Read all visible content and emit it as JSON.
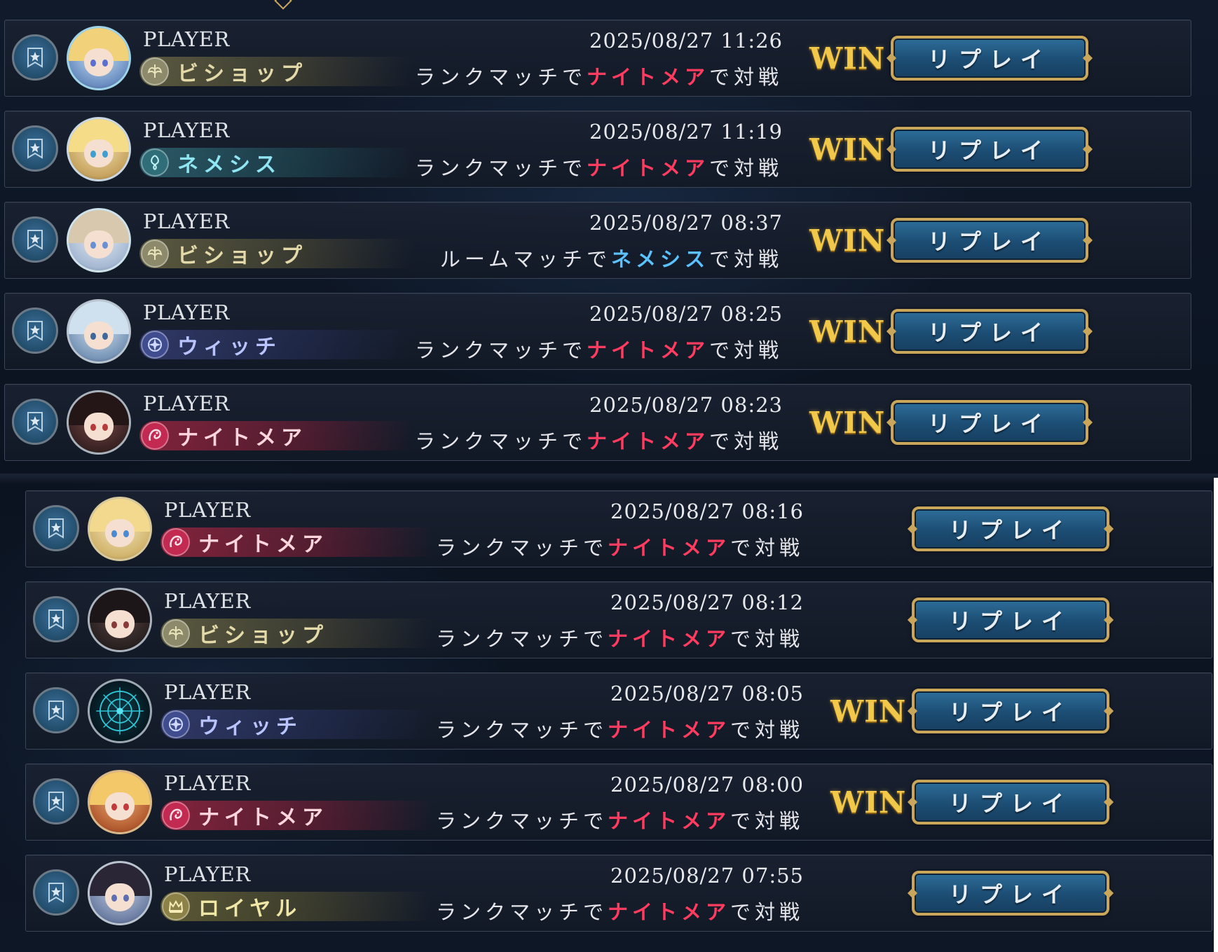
{
  "colors": {
    "nightmare": "#ff3c5f",
    "nemesis": "#5cc2ff",
    "win": "#f2c84b",
    "replay_bg": "#1c4d73",
    "replay_border": "#c9a65a"
  },
  "matches": [
    {
      "player": "PLAYER",
      "class": "ビショップ",
      "class_key": "bishop",
      "datetime": "2025/08/27 11:26",
      "mode": "ランクマッチで",
      "opponent": "ナイトメア",
      "opp_key": "nightmare",
      "suffix": "で対戦",
      "result": "WIN",
      "replay": "リプレイ"
    },
    {
      "player": "PLAYER",
      "class": "ネメシス",
      "class_key": "nemesis",
      "datetime": "2025/08/27 11:19",
      "mode": "ランクマッチで",
      "opponent": "ナイトメア",
      "opp_key": "nightmare",
      "suffix": "で対戦",
      "result": "WIN",
      "replay": "リプレイ"
    },
    {
      "player": "PLAYER",
      "class": "ビショップ",
      "class_key": "bishop",
      "datetime": "2025/08/27 08:37",
      "mode": "ルームマッチで",
      "opponent": "ネメシス",
      "opp_key": "nemesis",
      "suffix": "で対戦",
      "result": "WIN",
      "replay": "リプレイ"
    },
    {
      "player": "PLAYER",
      "class": "ウィッチ",
      "class_key": "witch",
      "datetime": "2025/08/27 08:25",
      "mode": "ランクマッチで",
      "opponent": "ナイトメア",
      "opp_key": "nightmare",
      "suffix": "で対戦",
      "result": "WIN",
      "replay": "リプレイ"
    },
    {
      "player": "PLAYER",
      "class": "ナイトメア",
      "class_key": "nightmare",
      "datetime": "2025/08/27 08:23",
      "mode": "ランクマッチで",
      "opponent": "ナイトメア",
      "opp_key": "nightmare",
      "suffix": "で対戦",
      "result": "WIN",
      "replay": "リプレイ"
    },
    {
      "player": "PLAYER",
      "class": "ナイトメア",
      "class_key": "nightmare",
      "datetime": "2025/08/27 08:16",
      "mode": "ランクマッチで",
      "opponent": "ナイトメア",
      "opp_key": "nightmare",
      "suffix": "で対戦",
      "result": "",
      "replay": "リプレイ"
    },
    {
      "player": "PLAYER",
      "class": "ビショップ",
      "class_key": "bishop",
      "datetime": "2025/08/27 08:12",
      "mode": "ランクマッチで",
      "opponent": "ナイトメア",
      "opp_key": "nightmare",
      "suffix": "で対戦",
      "result": "",
      "replay": "リプレイ"
    },
    {
      "player": "PLAYER",
      "class": "ウィッチ",
      "class_key": "witch",
      "datetime": "2025/08/27 08:05",
      "mode": "ランクマッチで",
      "opponent": "ナイトメア",
      "opp_key": "nightmare",
      "suffix": "で対戦",
      "result": "WIN",
      "replay": "リプレイ"
    },
    {
      "player": "PLAYER",
      "class": "ナイトメア",
      "class_key": "nightmare",
      "datetime": "2025/08/27 08:00",
      "mode": "ランクマッチで",
      "opponent": "ナイトメア",
      "opp_key": "nightmare",
      "suffix": "で対戦",
      "result": "WIN",
      "replay": "リプレイ"
    },
    {
      "player": "PLAYER",
      "class": "ロイヤル",
      "class_key": "royal",
      "datetime": "2025/08/27 07:55",
      "mode": "ランクマッチで",
      "opponent": "ナイトメア",
      "opp_key": "nightmare",
      "suffix": "で対戦",
      "result": "",
      "replay": "リプレイ"
    }
  ]
}
